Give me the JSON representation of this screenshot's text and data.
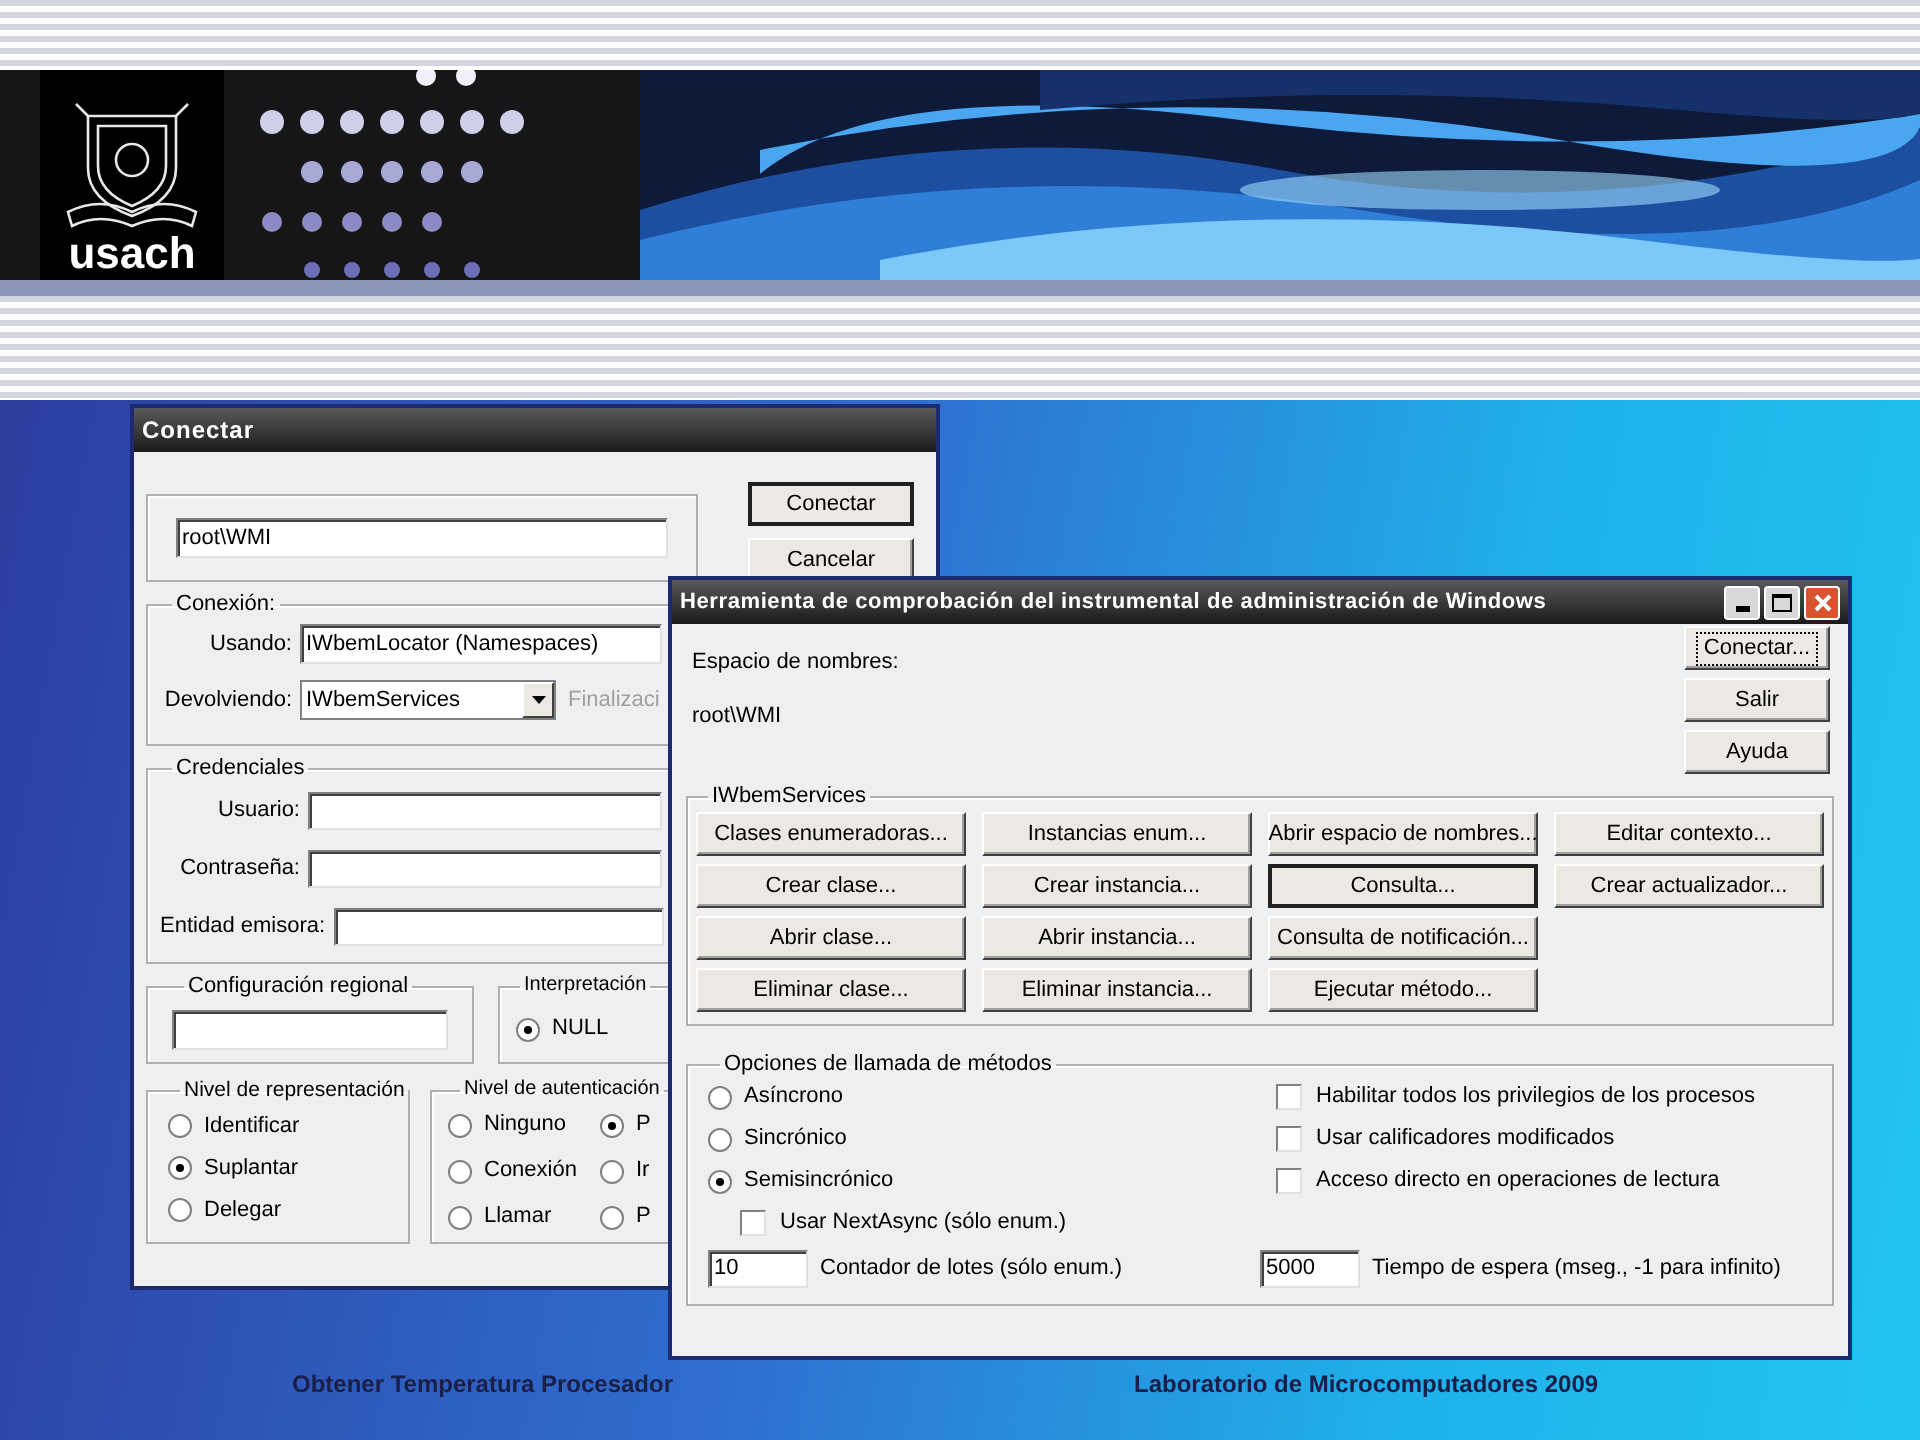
{
  "slide": {
    "logo_text": "usach",
    "footer": [
      "Obtener Temperatura Procesador",
      "Laboratorio de Microcomputadores 2009"
    ]
  },
  "connect_dialog": {
    "title": "Conectar",
    "namespace_value": "root\\WMI",
    "buttons": [
      {
        "label": "Conectar",
        "default": true
      },
      {
        "label": "Cancelar",
        "default": false
      }
    ],
    "connection": {
      "legend": "Conexión:",
      "using_label": "Usando:",
      "using_value": "IWbemLocator (Namespaces)",
      "returning_label": "Devolviendo:",
      "returning_value": "IWbemServices",
      "trailing": "Finalizaci"
    },
    "credentials": {
      "legend": "Credenciales",
      "fields": [
        {
          "label": "Usuario:"
        },
        {
          "label": "Contraseña:"
        },
        {
          "label": "Entidad emisora:"
        }
      ]
    },
    "locale": {
      "legend": "Configuración regional"
    },
    "interpretation": {
      "legend": "Interpretación",
      "options": [
        {
          "label": "NULL",
          "selected": true
        }
      ]
    },
    "impersonation": {
      "legend": "Nivel de representación",
      "options": [
        {
          "label": "Identificar",
          "selected": false
        },
        {
          "label": "Suplantar",
          "selected": true
        },
        {
          "label": "Delegar",
          "selected": false
        }
      ]
    },
    "authentication": {
      "legend": "Nivel de autenticación",
      "options": [
        {
          "label": "Ninguno",
          "selected": false
        },
        {
          "label": "Conexión",
          "selected": false
        },
        {
          "label": "Llamar",
          "selected": false
        },
        {
          "label": "P",
          "selected": true
        },
        {
          "label": "Ir",
          "selected": false
        },
        {
          "label": "P",
          "selected": false
        }
      ]
    }
  },
  "tool_window": {
    "title": "Herramienta de comprobación del instrumental de administración de Windows",
    "namespace_label": "Espacio de nombres:",
    "namespace_value": "root\\WMI",
    "buttons": [
      {
        "label": "Conectar...",
        "focused": true
      },
      {
        "label": "Salir",
        "focused": false
      },
      {
        "label": "Ayuda",
        "focused": false
      }
    ],
    "services": {
      "legend": "IWbemServices",
      "buttons": [
        {
          "label": "Clases enumeradoras...",
          "default": false
        },
        {
          "label": "Crear clase...",
          "default": false
        },
        {
          "label": "Abrir clase...",
          "default": false
        },
        {
          "label": "Eliminar clase...",
          "default": false
        },
        {
          "label": "Instancias enum...",
          "default": false
        },
        {
          "label": "Crear instancia...",
          "default": false
        },
        {
          "label": "Abrir instancia...",
          "default": false
        },
        {
          "label": "Eliminar instancia...",
          "default": false
        },
        {
          "label": "Abrir espacio de nombres...",
          "default": false
        },
        {
          "label": "Consulta...",
          "default": true
        },
        {
          "label": "Consulta de notificación...",
          "default": false
        },
        {
          "label": "Ejecutar método...",
          "default": false
        },
        {
          "label": "Editar contexto...",
          "default": false
        },
        {
          "label": "Crear actualizador...",
          "default": false
        }
      ]
    },
    "call_options": {
      "legend": "Opciones de llamada de métodos",
      "modes": [
        {
          "label": "Asíncrono",
          "selected": false
        },
        {
          "label": "Sincrónico",
          "selected": false
        },
        {
          "label": "Semisincrónico",
          "selected": true
        }
      ],
      "next_async": {
        "label": "Usar NextAsync (sólo enum.)",
        "checked": false
      },
      "batch": {
        "value": "10",
        "label": "Contador de lotes (sólo enum.)"
      },
      "flags": [
        {
          "label": "Habilitar todos los privilegios de los procesos",
          "checked": false
        },
        {
          "label": "Usar calificadores modificados",
          "checked": false
        },
        {
          "label": "Acceso directo en operaciones de lectura",
          "checked": false
        }
      ],
      "timeout": {
        "value": "5000",
        "label": "Tiempo de espera (mseg., -1 para infinito)"
      }
    }
  }
}
